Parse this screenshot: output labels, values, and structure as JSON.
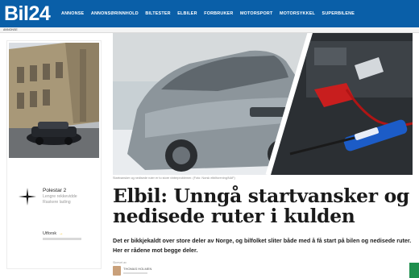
{
  "header": {
    "logo": "Bil24",
    "nav": [
      "ANNONSE",
      "ANNONSØRINNHOLD",
      "BILTESTER",
      "ELBILER",
      "FORBRUKER",
      "MOTORSPORT",
      "MOTORSYKKEL",
      "SUPERBILENE"
    ],
    "sub_label": "ANNONSE"
  },
  "ad": {
    "title": "Polestar 2",
    "subtitle_1": "Lengre rekkevidde",
    "subtitle_2": "Raskere lading",
    "cta": "Utforsk",
    "cta_arrow": "→"
  },
  "article": {
    "caption": "Startvansker og nedisede ruter er to store vinterproblemer. (Foto: Norsk elbilforening/NAF)",
    "headline": "Elbil: Unngå startvansker og nedisede ruter i kulden",
    "lead": "Det er bikkjekaldt over store deler av Norge, og bilfolket sliter både med å få start på bilen og nedisede ruter. Her er rådene mot begge deler.",
    "byline_label": "Skrevet av",
    "author": "THOMAS HOLMEN"
  },
  "colors": {
    "brand": "#0a5fa8",
    "headline": "#1a1a1a",
    "accent_yellow": "#f0b800",
    "side_tab": "#1f8f4e"
  }
}
